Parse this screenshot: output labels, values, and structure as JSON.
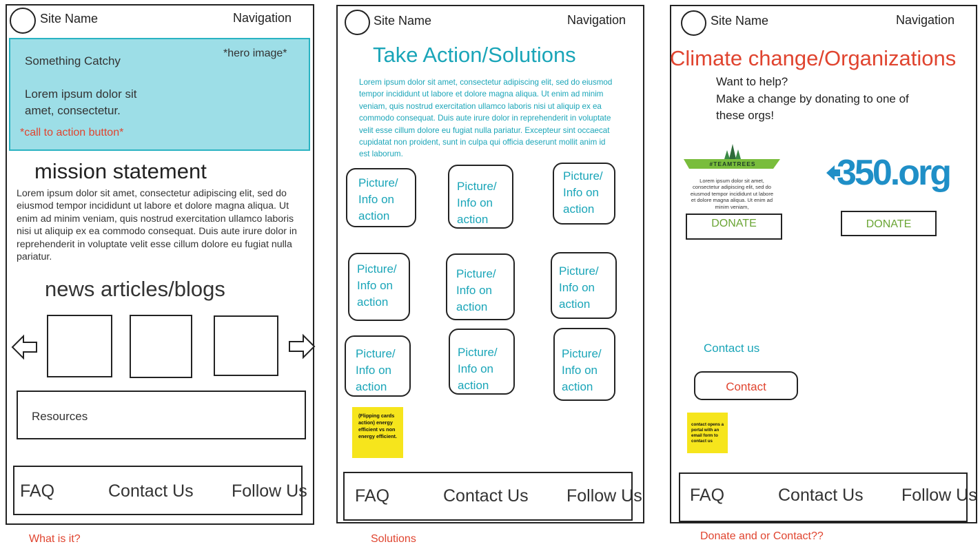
{
  "panels": [
    {
      "site_name": "Site Name",
      "nav": "Navigation",
      "hero": {
        "title": "Something Catchy",
        "body": "Lorem ipsum dolor sit amet, consectetur.",
        "image_note": "*hero image*",
        "cta": "*call to action button*"
      },
      "mission_title": "mission statement",
      "mission_body": "Lorem ipsum dolor sit amet, consectetur adipiscing elit, sed do eiusmod tempor incididunt ut labore et dolore magna aliqua. Ut enim ad minim veniam, quis nostrud exercitation ullamco laboris nisi ut aliquip ex ea commodo consequat. Duis aute irure dolor in reprehenderit in voluptate velit esse cillum dolore eu fugiat nulla pariatur.",
      "news_title": "news articles/blogs",
      "resources": "Resources",
      "footer": {
        "faq": "FAQ",
        "contact": "Contact Us",
        "follow": "Follow Us"
      },
      "caption": "What is it?"
    },
    {
      "site_name": "Site Name",
      "nav": "Navigation",
      "title": "Take Action/Solutions",
      "body": "Lorem ipsum dolor sit amet, consectetur adipiscing elit, sed do eiusmod tempor incididunt ut labore et dolore magna aliqua. Ut enim ad minim veniam, quis nostrud exercitation ullamco laboris nisi ut aliquip ex ea commodo consequat. Duis aute irure dolor in reprehenderit in voluptate velit esse cillum dolore eu fugiat nulla pariatur. Excepteur sint occaecat cupidatat non proident, sunt in culpa qui officia deserunt mollit anim id est laborum.",
      "card_label": "Picture/ Info on action",
      "sticky": "(Flipping cards action) energy efficient vs non energy efficient.",
      "footer": {
        "faq": "FAQ",
        "contact": "Contact Us",
        "follow": "Follow Us"
      },
      "caption": "Solutions"
    },
    {
      "site_name": "Site Name",
      "nav": "Navigation",
      "title": "Climate change/Organizations",
      "intro_line1": "Want to help?",
      "intro_line2": "Make a change by donating to one of these orgs!",
      "teamtrees_logo": "#TEAMTREES",
      "teamtrees_body": "Lorem ipsum dolor sit amet, consectetur adipiscing elit, sed do eiusmod tempor incididunt ut labore et dolore magna aliqua. Ut enim ad minim veniam,",
      "org350_logo": "350.org",
      "donate1": "DONATE",
      "donate2": "DONATE",
      "contact_us": "Contact us",
      "contact_button": "Contact",
      "sticky": "contact opens a portal with an email form to contact us",
      "footer": {
        "faq": "FAQ",
        "contact": "Contact Us",
        "follow": "Follow Us"
      },
      "caption": "Donate and or Contact??"
    }
  ],
  "colors": {
    "hero_bg": "#9ddee7",
    "hero_border": "#29b3c2",
    "teal_text": "#1aa5b8",
    "red_text": "#e0442f",
    "green_text": "#6aa534",
    "sticky": "#f6e51c",
    "org350": "#1f8fc7"
  }
}
